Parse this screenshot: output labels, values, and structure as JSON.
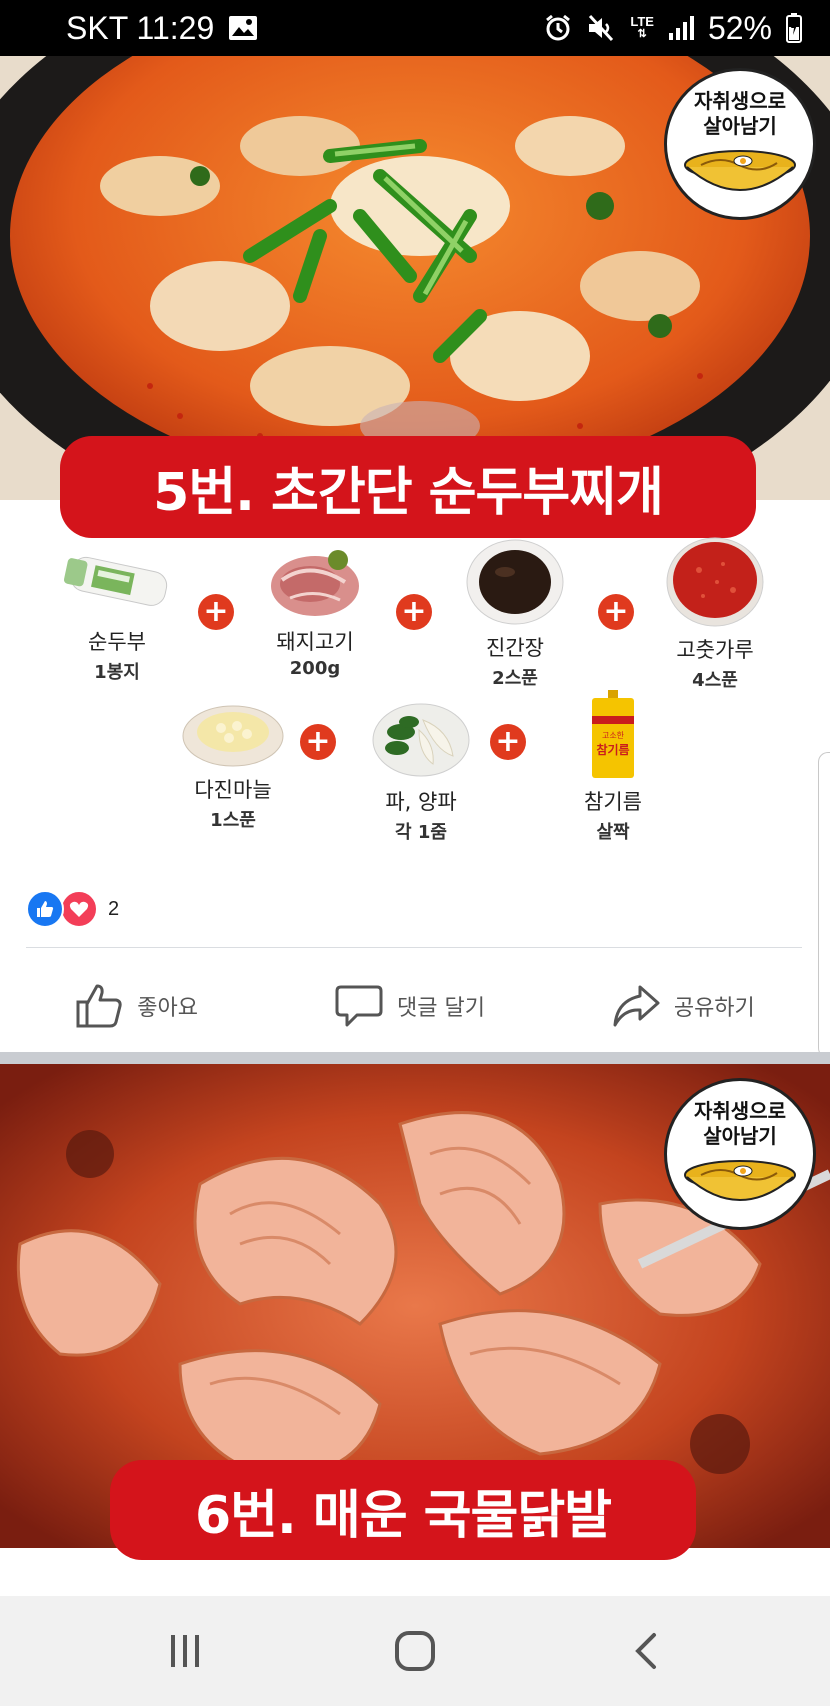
{
  "status_bar": {
    "carrier_time": "SKT 11:29",
    "network": "LTE",
    "battery": "52%",
    "icons": [
      "image-icon",
      "alarm-icon",
      "mute-icon",
      "signal-icon",
      "battery-icon"
    ]
  },
  "post1": {
    "badge_line1": "자취생으로",
    "badge_line2": "살아남기",
    "title": "5번. 초간단 순두부찌개",
    "ingredients": [
      {
        "name": "순두부",
        "amount": "1봉지",
        "icon": "soft-tofu-pack"
      },
      {
        "name": "돼지고기",
        "amount": "200g",
        "icon": "pork-meat"
      },
      {
        "name": "진간장",
        "amount": "2스푼",
        "icon": "soy-sauce-bowl"
      },
      {
        "name": "고춧가루",
        "amount": "4스푼",
        "icon": "chili-powder-bowl"
      },
      {
        "name": "다진마늘",
        "amount": "1스푼",
        "icon": "minced-garlic"
      },
      {
        "name": "파, 양파",
        "amount": "각 1줌",
        "icon": "green-onion-onion"
      },
      {
        "name": "참기름",
        "amount": "살짝",
        "icon": "sesame-oil-can",
        "can_label_small": "고소한",
        "can_label": "참기름"
      }
    ],
    "reaction_count": "2"
  },
  "actions": {
    "like": "좋아요",
    "comment": "댓글 달기",
    "share": "공유하기"
  },
  "post2": {
    "badge_line1": "자취생으로",
    "badge_line2": "살아남기",
    "title": "6번. 매운 국물닭발"
  },
  "colors": {
    "banner_red": "#d4141b",
    "plus_red": "#e03a1e",
    "like_blue": "#1877f2",
    "love_red": "#f33e58"
  }
}
